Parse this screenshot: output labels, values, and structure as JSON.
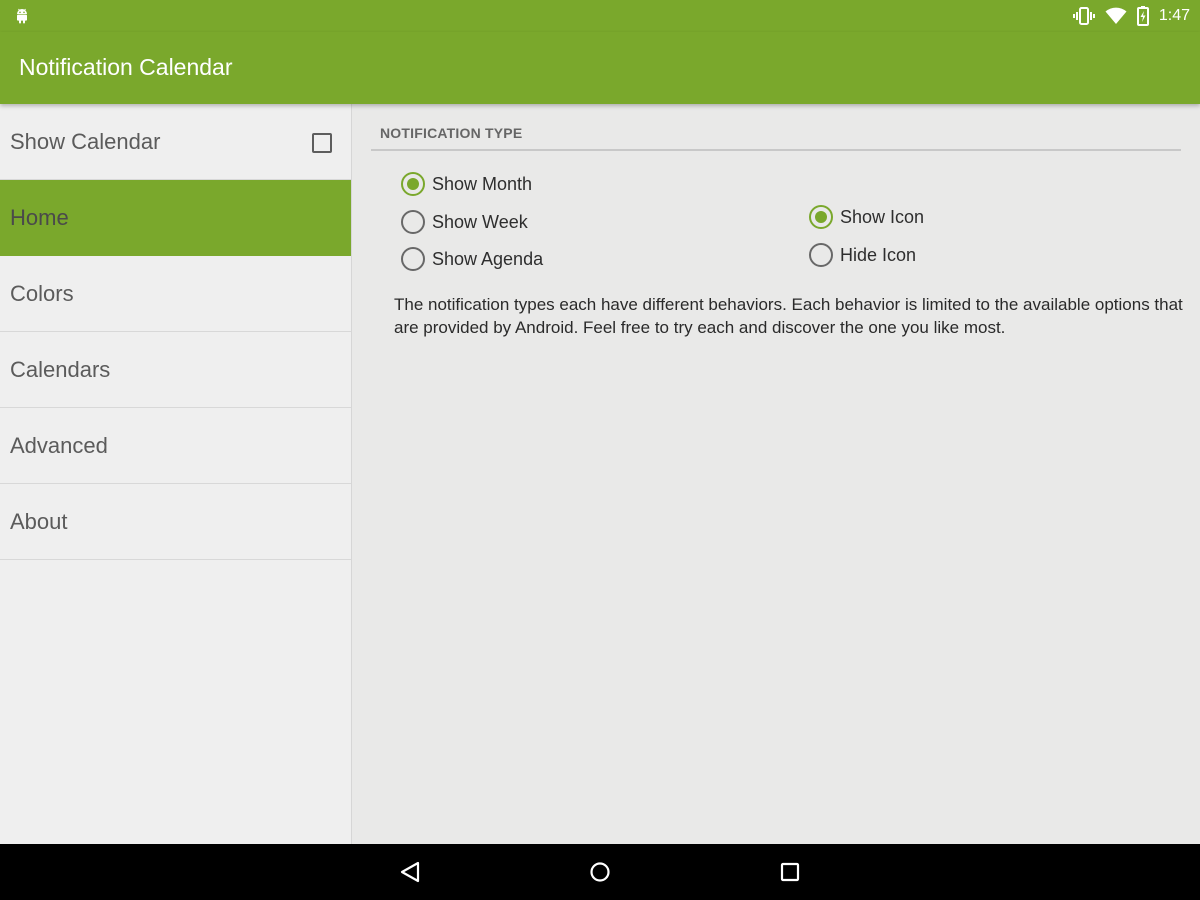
{
  "status_bar": {
    "time": "1:47",
    "icons": [
      "android-icon",
      "vibrate-icon",
      "wifi-icon",
      "battery-charging-icon"
    ]
  },
  "toolbar": {
    "title": "Notification Calendar"
  },
  "sidebar": {
    "items": [
      {
        "label": "Show Calendar",
        "type": "checkbox",
        "checked": false
      },
      {
        "label": "Home",
        "active": true
      },
      {
        "label": "Colors"
      },
      {
        "label": "Calendars"
      },
      {
        "label": "Advanced"
      },
      {
        "label": "About"
      }
    ]
  },
  "content": {
    "section_title": "NOTIFICATION TYPE",
    "view_options": [
      {
        "label": "Show Month",
        "checked": true
      },
      {
        "label": "Show Week",
        "checked": false
      },
      {
        "label": "Show Agenda",
        "checked": false
      }
    ],
    "icon_options": [
      {
        "label": "Show Icon",
        "checked": true
      },
      {
        "label": "Hide Icon",
        "checked": false
      }
    ],
    "description": "The notification types each have different behaviors. Each behavior is limited to the available options that are provided by Android. Feel free to try each and discover the one you like most."
  },
  "nav_bar": {
    "buttons": [
      "back-icon",
      "home-icon",
      "recents-icon"
    ]
  },
  "colors": {
    "accent": "#7aa82c",
    "background": "#e9e9e8",
    "sidebar_background": "#efefef",
    "nav_bar": "#000000"
  }
}
